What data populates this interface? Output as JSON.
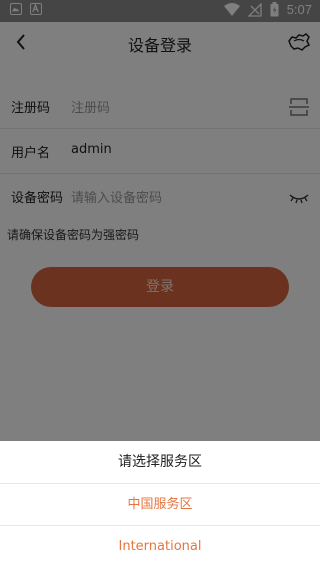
{
  "status_bar": {
    "time": "5:07",
    "icons": [
      "image-icon",
      "text-icon",
      "wifi-icon",
      "no-signal-icon",
      "battery-icon"
    ]
  },
  "app_bar": {
    "title": "设备登录",
    "back_icon": "chevron-left-icon",
    "right_icon": "map-icon"
  },
  "form": {
    "reg_code": {
      "label": "注册码",
      "placeholder": "注册码",
      "icon": "scan-icon"
    },
    "username": {
      "label": "用户名",
      "value": "admin"
    },
    "password": {
      "label": "设备密码",
      "placeholder": "请输入设备密码",
      "icon": "eye-closed-icon"
    }
  },
  "hint": "请确保设备密码为强密码",
  "login_label": "登录",
  "colors": {
    "accent": "#d6673f",
    "option_text": "#e6743f",
    "status_bar": "#8a8a8a"
  },
  "sheet": {
    "title": "请选择服务区",
    "options": [
      "中国服务区",
      "International"
    ]
  }
}
